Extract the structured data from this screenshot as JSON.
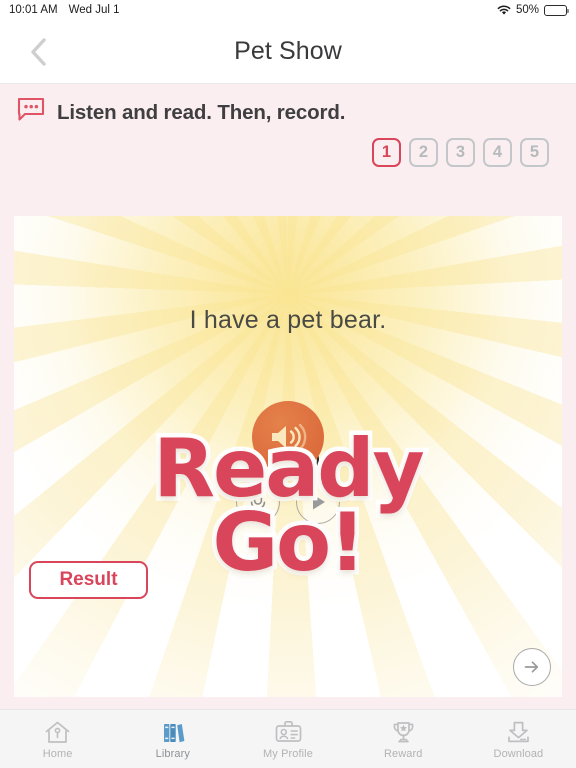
{
  "statusbar": {
    "time": "10:01 AM",
    "date": "Wed Jul 1",
    "battery_percent": "50%",
    "wifi_icon": "wifi-icon",
    "battery_icon": "battery-icon"
  },
  "header": {
    "title": "Pet Show",
    "back_icon": "chevron-left-icon"
  },
  "instruction": {
    "icon": "speech-bubble-icon",
    "text": "Listen and read. Then, record."
  },
  "pager": {
    "pages": [
      "1",
      "2",
      "3",
      "4",
      "5"
    ],
    "active_index": 0
  },
  "content": {
    "sentence": "I have a pet bear.",
    "speaker_icon": "speaker-volume-icon",
    "overlay": {
      "line1": "Ready",
      "line2": "Go!"
    },
    "timer": "00:00",
    "record_icon": "microphone-icon",
    "play_icon": "play-icon",
    "result_label": "Result",
    "next_icon": "arrow-right-icon"
  },
  "tabbar": {
    "items": [
      {
        "label": "Home",
        "icon": "home-icon",
        "active": false
      },
      {
        "label": "Library",
        "icon": "books-icon",
        "active": true
      },
      {
        "label": "My Profile",
        "icon": "id-badge-icon",
        "active": false
      },
      {
        "label": "Reward",
        "icon": "trophy-icon",
        "active": false
      },
      {
        "label": "Download",
        "icon": "download-icon",
        "active": false
      }
    ]
  },
  "colors": {
    "accent_red": "#d9455a",
    "page_bg": "#fbeef0",
    "speaker_orange": "#dd6f3f",
    "library_blue": "#5a9bc9",
    "inactive_gray": "#b6babd"
  }
}
